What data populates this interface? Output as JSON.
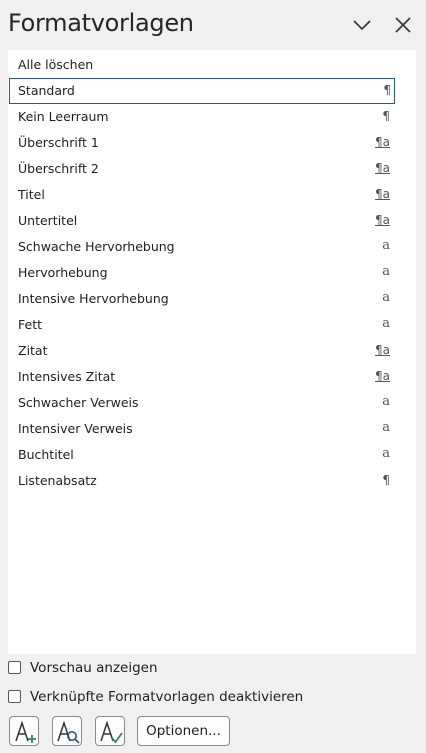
{
  "pane": {
    "title": "Formatvorlagen"
  },
  "styles": [
    {
      "label": "Alle löschen",
      "mark": ""
    },
    {
      "label": "Standard",
      "mark": "¶",
      "selected": true
    },
    {
      "label": "Kein Leerraum",
      "mark": "¶"
    },
    {
      "label": "Überschrift 1",
      "mark": "¶a"
    },
    {
      "label": "Überschrift 2",
      "mark": "¶a"
    },
    {
      "label": "Titel",
      "mark": "¶a"
    },
    {
      "label": "Untertitel",
      "mark": "¶a"
    },
    {
      "label": "Schwache Hervorhebung",
      "mark": "a"
    },
    {
      "label": "Hervorhebung",
      "mark": "a"
    },
    {
      "label": "Intensive Hervorhebung",
      "mark": "a"
    },
    {
      "label": "Fett",
      "mark": "a"
    },
    {
      "label": "Zitat",
      "mark": "¶a"
    },
    {
      "label": "Intensives Zitat",
      "mark": "¶a"
    },
    {
      "label": "Schwacher Verweis",
      "mark": "a"
    },
    {
      "label": "Intensiver Verweis",
      "mark": "a"
    },
    {
      "label": "Buchtitel",
      "mark": "a"
    },
    {
      "label": "Listenabsatz",
      "mark": "¶"
    }
  ],
  "options": {
    "preview_label": "Vorschau anzeigen",
    "preview_checked": false,
    "linked_label": "Verknüpfte Formatvorlagen deaktivieren",
    "linked_checked": false
  },
  "toolbar": {
    "new_style_icon": "new-style-icon",
    "style_inspector_icon": "style-inspector-icon",
    "manage_styles_icon": "manage-styles-icon",
    "options_label": "Optionen..."
  },
  "colors": {
    "accent": "#2b579a",
    "new_style_plus": "#2e8b57",
    "inspector_lens": "#2b579a",
    "manage_check": "#2e8b57"
  }
}
